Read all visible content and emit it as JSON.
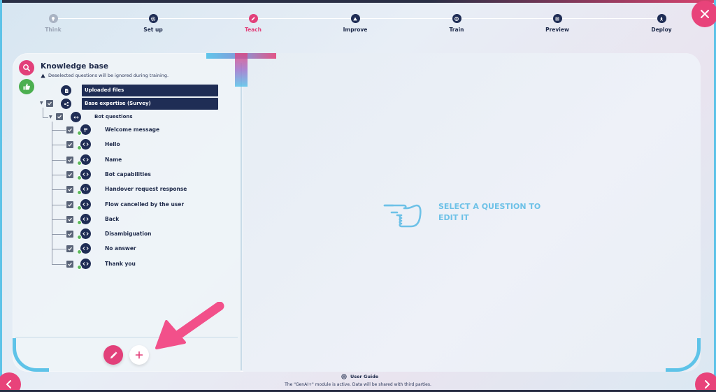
{
  "stepper": {
    "steps": [
      {
        "label": "Think",
        "state": "disabled",
        "icon": "bulb-icon"
      },
      {
        "label": "Set up",
        "state": "done",
        "icon": "gear-icon"
      },
      {
        "label": "Teach",
        "state": "active",
        "icon": "pencil-icon"
      },
      {
        "label": "Improve",
        "state": "done",
        "icon": "triangle-icon"
      },
      {
        "label": "Train",
        "state": "done",
        "icon": "brain-icon"
      },
      {
        "label": "Preview",
        "state": "done",
        "icon": "list-icon"
      },
      {
        "label": "Deploy",
        "state": "done",
        "icon": "rocket-icon"
      }
    ]
  },
  "left": {
    "title": "Knowledge base",
    "warning": "Deselected questions will be ignored during training.",
    "uploaded_files": "Uploaded files",
    "base_expertise": "Base expertise (Survey)",
    "bot_questions": "Bot questions",
    "questions": [
      {
        "label": "Welcome message",
        "checked": true,
        "icon": "message-icon"
      },
      {
        "label": "Hello",
        "checked": true,
        "icon": "code-icon"
      },
      {
        "label": "Name",
        "checked": true,
        "icon": "code-icon"
      },
      {
        "label": "Bot capabilities",
        "checked": true,
        "icon": "code-icon"
      },
      {
        "label": "Handover request response",
        "checked": true,
        "icon": "code-icon"
      },
      {
        "label": "Flow cancelled by the user",
        "checked": true,
        "icon": "code-icon"
      },
      {
        "label": "Back",
        "checked": true,
        "icon": "code-icon"
      },
      {
        "label": "Disambiguation",
        "checked": true,
        "icon": "code-icon"
      },
      {
        "label": "No answer",
        "checked": true,
        "icon": "code-icon"
      },
      {
        "label": "Thank you",
        "checked": true,
        "icon": "code-icon"
      }
    ]
  },
  "right": {
    "placeholder_line1": "SELECT A QUESTION TO",
    "placeholder_line2": "EDIT IT"
  },
  "footer": {
    "guide": "User Guide",
    "notice": "The \"GenAI+\" module is active. Data will be shared with third parties."
  },
  "colors": {
    "accent": "#e2407a",
    "navy": "#1f2d55",
    "cyan": "#5ec3e8",
    "green": "#4caf50"
  }
}
